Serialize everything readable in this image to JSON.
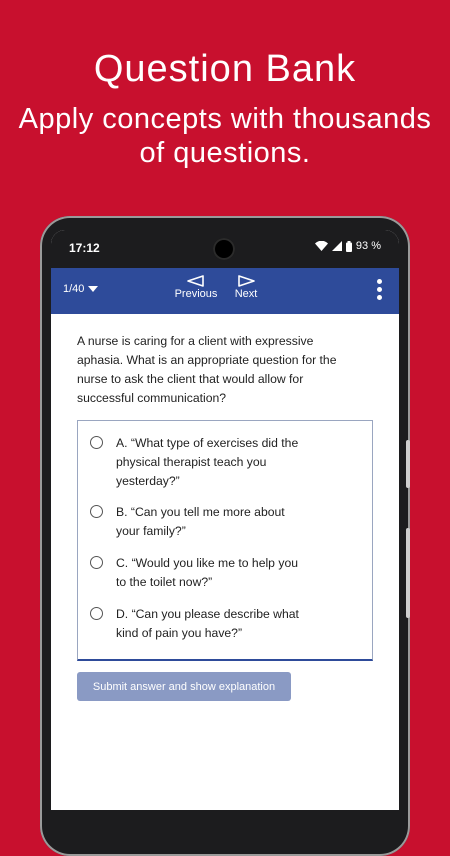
{
  "promo": {
    "title": "Question Bank",
    "subtitle_line1": "Apply concepts with thousands",
    "subtitle_line2": "of questions."
  },
  "status_bar": {
    "time": "17:12",
    "battery": "93 %",
    "icons": [
      "wifi-icon",
      "signal-icon",
      "battery-icon"
    ]
  },
  "app_bar": {
    "counter": "1/40",
    "previous_label": "Previous",
    "next_label": "Next",
    "icons": [
      "chevron-down-icon",
      "arrow-left-icon",
      "arrow-right-icon",
      "more-vert-icon"
    ]
  },
  "question": {
    "line1": "A nurse is caring for a client with expressive",
    "line2": "aphasia. What is an appropriate question for the",
    "line3": "nurse to ask the client that would allow for",
    "line4": "successful communication?"
  },
  "options": [
    {
      "lines": [
        "A. “What type of exercises did the",
        "physical therapist teach you",
        "yesterday?”"
      ],
      "selected": false
    },
    {
      "lines": [
        "B. “Can you tell me more about",
        "your family?”"
      ],
      "selected": false
    },
    {
      "lines": [
        "C. “Would you like me to help you",
        "to the toilet now?”"
      ],
      "selected": false
    },
    {
      "lines": [
        "D. “Can you please describe what",
        "kind of pain you have?”"
      ],
      "selected": false
    }
  ],
  "submit_label": "Submit answer and show explanation",
  "colors": {
    "background": "#c8102e",
    "app_bar": "#2e4b9a",
    "submit_button": "#8a9ac4"
  }
}
